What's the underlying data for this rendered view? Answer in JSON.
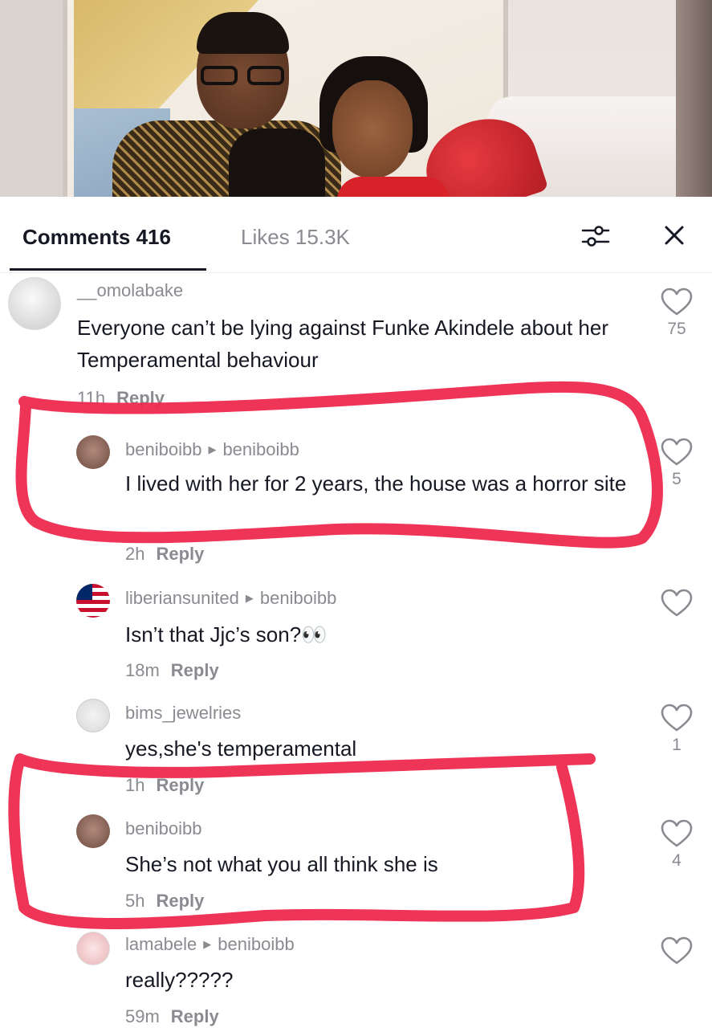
{
  "tabs": {
    "comments_label": "Comments 416",
    "likes_label": "Likes 15.3K"
  },
  "icons": {
    "filter": "sliders-icon",
    "close": "close-icon",
    "like": "heart-outline-icon"
  },
  "colors": {
    "highlight": "#ee2a4e",
    "muted_text": "#8a8b91",
    "primary_text": "#161823"
  },
  "comments": [
    {
      "username": "__omolabake",
      "reply_to": "",
      "text": "Everyone can’t be lying against Funke Akindele about her Temperamental behaviour",
      "time": "11h",
      "reply_label": "Reply",
      "likes": "75"
    },
    {
      "username": "beniboibb",
      "reply_to": "beniboibb",
      "text": "I lived with her for 2 years, the house was a horror site",
      "time": "2h",
      "reply_label": "Reply",
      "likes": "5"
    },
    {
      "username": "liberiansunited",
      "reply_to": "beniboibb",
      "text": "Isn’t that Jjc’s son?👀",
      "time": "18m",
      "reply_label": "Reply",
      "likes": ""
    },
    {
      "username": "bims_jewelries",
      "reply_to": "",
      "text": "yes,she's temperamental",
      "time": "1h",
      "reply_label": "Reply",
      "likes": "1"
    },
    {
      "username": "beniboibb",
      "reply_to": "",
      "text": "She’s not what you all think she is",
      "time": "5h",
      "reply_label": "Reply",
      "likes": "4"
    },
    {
      "username": "lamabele",
      "reply_to": "beniboibb",
      "text": "really?????",
      "time": "59m",
      "reply_label": "Reply",
      "likes": ""
    }
  ]
}
